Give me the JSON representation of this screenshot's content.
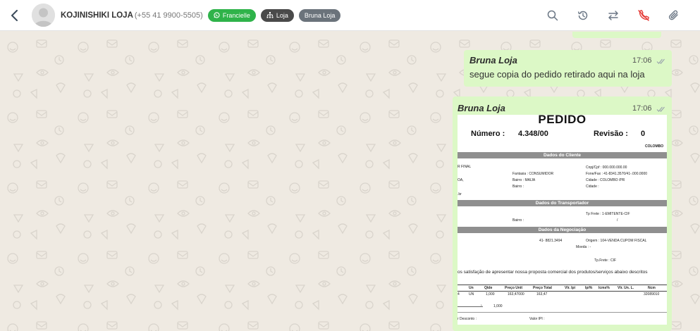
{
  "header": {
    "contact_name": "KOJINISHIKI LOJA",
    "contact_phone": "(+55 41 9900-5505)",
    "tags": [
      "Francielle",
      "Loja",
      "Bruna Loja"
    ]
  },
  "icons": [
    "back-arrow-icon",
    "search-icon",
    "history-icon",
    "transfer-icon",
    "phone-off-icon",
    "attachment-icon"
  ],
  "colors": {
    "bubble": "#dcf8c6",
    "tag_whatsapp": "#2fb34a",
    "tag_loja": "#4a4a4a",
    "tag_bruna": "#6b737b",
    "end_call_red": "#e53935"
  },
  "messages": [
    {
      "sender": "Bruna Loja",
      "time": "17:06",
      "text": "segue copia do pedido retirado aqui na loja"
    },
    {
      "sender": "Bruna Loja",
      "time": "17:06",
      "document": {
        "title": "PEDIDO",
        "numero_label": "Número :",
        "numero_value": "4.348/00",
        "revisao_label": "Revisão :",
        "revisao_value": "0",
        "city": "COLOMBO",
        "sec_cliente": "Dados do Cliente",
        "sec_transportador": "Dados do Transportador",
        "sec_negociacao": "Dados da Negociação",
        "cli_left1": "R FINAL",
        "cli_left2": "OA,",
        "cli_left3": ".br",
        "cli_fantasia": "Fantasia   :  CONSUMIDOR",
        "cli_bairro1": "Bairro      :  MAIJA",
        "cli_bairro2": "Bairro      :",
        "cli_cnpj": "Cnpj/Cpf       :   000.000.000.00",
        "cli_fone": "Fone/Fax       :   41-8341.3570/41-.000.0000",
        "cli_cidade1": "Cidade           :   COLOMBO        /PR",
        "cli_cidade2": "Cidade           :",
        "tr_frete": "Tp Frete      :   1-EMITENTE-CIF",
        "tr_slash": "/",
        "tr_bairro": "Bairro      :",
        "ng_fone": "41- 8821.3494",
        "ng_origem": "Origem        :   104-VENDA CUPOM FISCAL",
        "ng_moeda": "Moeda       :   -",
        "ng_frete": "Tp.Frete      :   CIF",
        "proposal": "os satisfação de apresentar nossa proposta comercial dos produtos/serviços abaixo descritos",
        "th": [
          "Un",
          "Qtde",
          "Preço Unit",
          "Preço Total",
          "Vlr. Ipi",
          "Ipi%",
          "Icms%",
          "Vlr. Un. L.",
          "Ncm"
        ],
        "row": [
          "UN",
          "1,000",
          "163,47000",
          "163,47",
          "32089010"
        ],
        "row_prefix": "4",
        "total_qtde": "1,000",
        "footer_desconto": "r Desconto      :",
        "footer_ipi": "Valor IPI          :"
      }
    }
  ]
}
